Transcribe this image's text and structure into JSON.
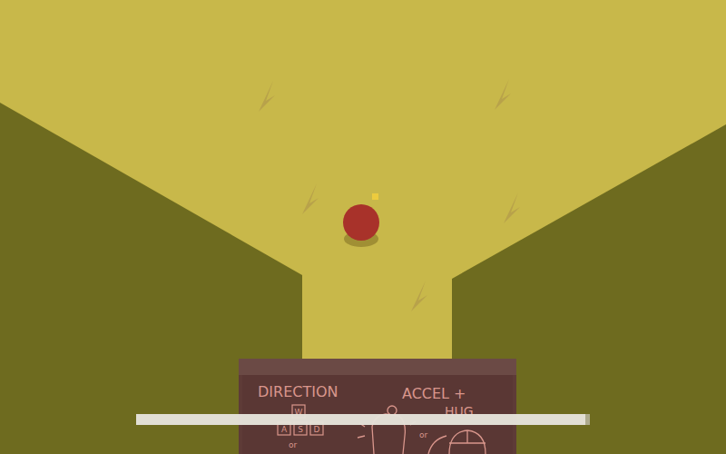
{
  "sign": {
    "direction": {
      "title": "DIRECTION",
      "keys": [
        "W",
        "A",
        "S",
        "D"
      ],
      "alt": "or"
    },
    "accel": {
      "title": "ACCEL +",
      "subtitle": "HUG",
      "alt": "or"
    }
  },
  "loading_bar": {
    "level": 0.99
  }
}
